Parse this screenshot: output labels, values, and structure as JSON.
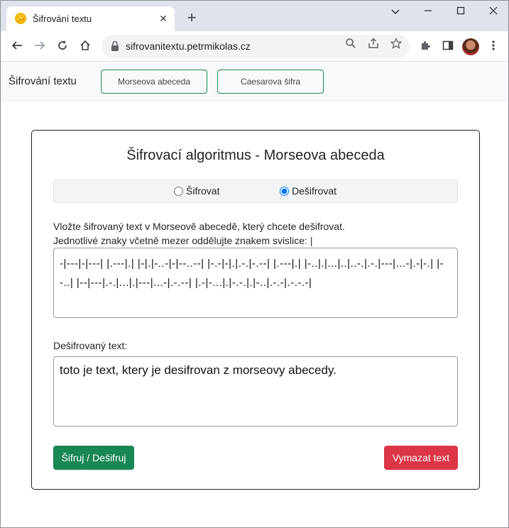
{
  "browser": {
    "tab_title": "Šifrování textu",
    "url": "sifrovanitextu.petrmikolas.cz",
    "new_tab_symbol": "+",
    "tab_close_symbol": "✕"
  },
  "navbar": {
    "brand": "Šifrování textu",
    "buttons": [
      "Morseova abeceda",
      "Caesarova šifra"
    ]
  },
  "card": {
    "title": "Šifrovací algoritmus - Morseova abeceda",
    "modes": [
      {
        "label": "Šifrovat",
        "selected": false
      },
      {
        "label": "Dešifrovat",
        "selected": true
      }
    ],
    "instruction_line1": "Vložte šifrovaný text v Morseově abecedě, který chcete dešifrovat.",
    "instruction_line2": "Jednotlivé znaky včetně mezer oddělujte znakem svislice: |",
    "input_text": "-|---|-|---| |.---|.| |-|.|-..-|-|--..--| |-.-|-|.|.-.|-.--| |.---|.| |-..|.|...|..|..-.|.-.|---|...-|.-|-.| |--..| |--|---|.-.|...|.|---|...-|.-.--| |.-|-...|.|-.-.|.|-..|.-.-|.-.-.-|",
    "output_label": "Dešifrovaný text:",
    "output_text": "toto je text, ktery je desifrovan z morseovy abecedy.",
    "submit_label": "Šifruj / Dešifruj",
    "clear_label": "Vymazat text"
  },
  "colors": {
    "success": "#198754",
    "danger": "#dc3545"
  }
}
